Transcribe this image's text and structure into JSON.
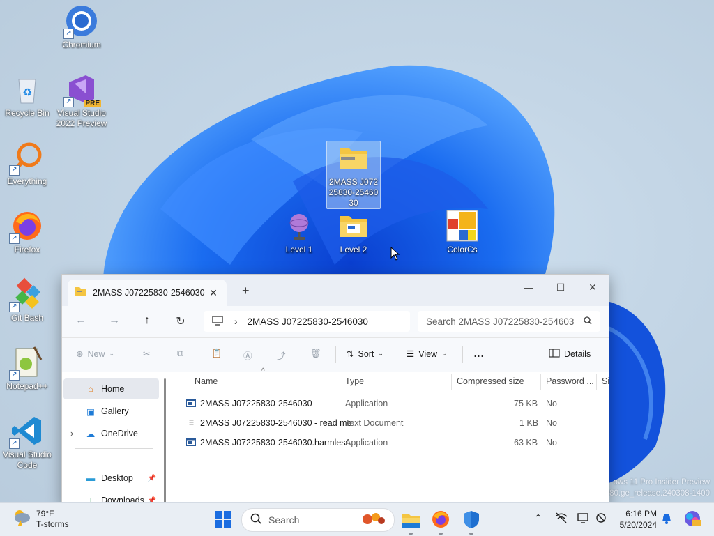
{
  "desktop": {
    "icons": [
      {
        "label": "Chromium"
      },
      {
        "label": "Recycle Bin"
      },
      {
        "label": "Visual Studio 2022 Preview",
        "badge": "PRE"
      },
      {
        "label": "Everything"
      },
      {
        "label": "Firefox"
      },
      {
        "label": "Git Bash"
      },
      {
        "label": "Notepad++"
      },
      {
        "label": "Visual Studio Code"
      },
      {
        "label": "2MASS J07225830-2546030"
      },
      {
        "label": "Level 1"
      },
      {
        "label": "Level 2"
      },
      {
        "label": "ColorCs"
      }
    ],
    "watermark": [
      "ows 11 Pro Insider Preview",
      "080.ge_release.240308-1400"
    ]
  },
  "explorer": {
    "tab_title": "2MASS J07225830-2546030",
    "address": "2MASS J07225830-2546030",
    "search_placeholder": "Search 2MASS J07225830-254603",
    "toolbar": {
      "new": "New",
      "sort": "Sort",
      "view": "View",
      "more": "...",
      "details": "Details"
    },
    "sidebar": [
      {
        "label": "Home",
        "selected": true
      },
      {
        "label": "Gallery"
      },
      {
        "label": "OneDrive"
      },
      {
        "label": "Desktop"
      },
      {
        "label": "Downloads"
      }
    ],
    "columns": [
      "Name",
      "Type",
      "Compressed size",
      "Password ...",
      "Si"
    ],
    "files": [
      {
        "name": "2MASS J07225830-2546030",
        "type": "Application",
        "size": "75 KB",
        "password": "No",
        "icon": "application-icon"
      },
      {
        "name": "2MASS J07225830-2546030 - read me",
        "type": "Text Document",
        "size": "1 KB",
        "password": "No",
        "icon": "text-document-icon"
      },
      {
        "name": "2MASS J07225830-2546030.harmless",
        "type": "Application",
        "size": "63 KB",
        "password": "No",
        "icon": "application-icon"
      }
    ]
  },
  "taskbar": {
    "weather_temp": "79°F",
    "weather_cond": "T-storms",
    "search_label": "Search",
    "time": "6:16 PM",
    "date": "5/20/2024"
  },
  "colors": {
    "accent": "#0067c0",
    "folder": "#f4c542",
    "taskbar": "#e9eef4"
  }
}
